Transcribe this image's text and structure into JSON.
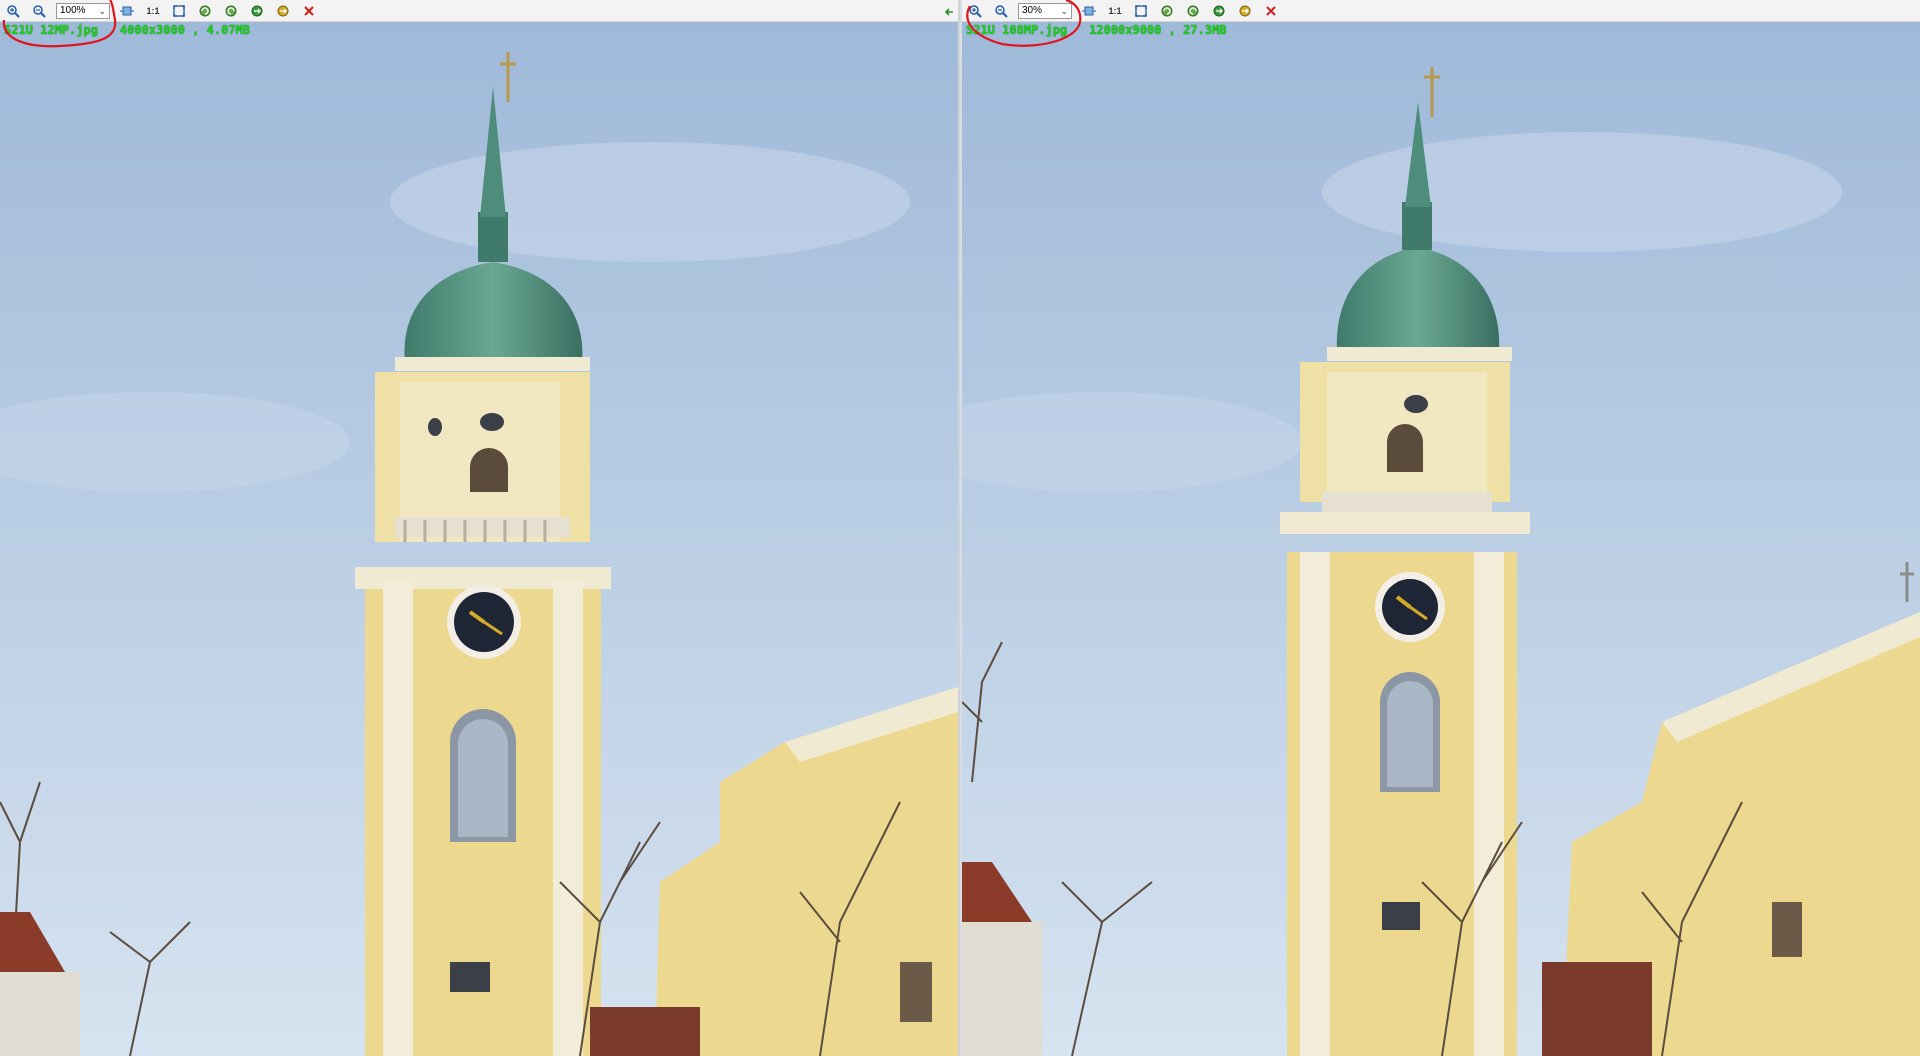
{
  "left": {
    "zoom": "100%",
    "filename": "S21U 12MP.jpg",
    "dimensions": "4000x3000",
    "size": "4.07MB"
  },
  "right": {
    "zoom": "30%",
    "filename": "S21U 108MP.jpg",
    "dimensions": "12000x9000",
    "size": "27.3MB"
  },
  "toolbar": {
    "one_to_one_label": "1:1",
    "icons": [
      "zoom-in-icon",
      "zoom-out-icon",
      "zoom-select",
      "fit-icon",
      "one-to-one",
      "fit-window-icon",
      "rotate-left-icon",
      "rotate-right-icon",
      "refresh-icon",
      "save-icon",
      "close-icon"
    ]
  },
  "colors": {
    "info_text": "#19d419",
    "annotation_circle": "#e0141c",
    "sky_top": "#9fb9d9",
    "sky_bottom": "#d6e3f0",
    "tower_yellow": "#eddc98",
    "dome_green": "#4e8d7c"
  }
}
